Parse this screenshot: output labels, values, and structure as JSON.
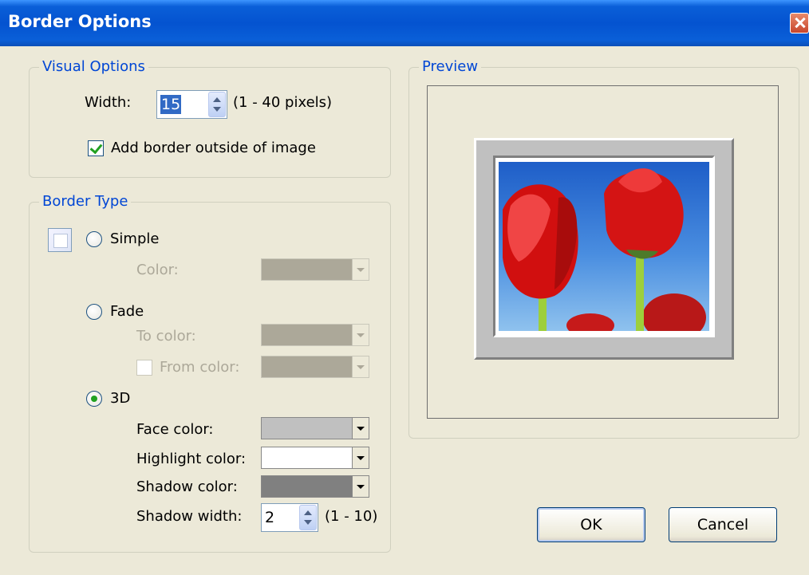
{
  "window": {
    "title": "Border Options"
  },
  "visual_options": {
    "legend": "Visual Options",
    "width_label": "Width:",
    "width_value": "15",
    "width_range": "(1 - 40 pixels)",
    "outside_label": "Add border outside of image",
    "outside_checked": true
  },
  "border_type": {
    "legend": "Border Type",
    "simple": {
      "label": "Simple",
      "selected": false,
      "color_label": "Color:"
    },
    "fade": {
      "label": "Fade",
      "selected": false,
      "to_color_label": "To color:",
      "from_color_label": "From color:"
    },
    "three_d": {
      "label": "3D",
      "selected": true,
      "face_label": "Face color:",
      "highlight_label": "Highlight color:",
      "shadow_label": "Shadow color:",
      "shadow_width_label": "Shadow width:",
      "shadow_width_value": "2",
      "shadow_width_range": "(1 - 10)"
    }
  },
  "preview": {
    "legend": "Preview"
  },
  "buttons": {
    "ok": "OK",
    "cancel": "Cancel"
  },
  "colors": {
    "face": "#c0c0c0",
    "highlight": "#ffffff",
    "shadow": "#808080",
    "disabled_swatch": "#aca899",
    "legend_text": "#0046d5",
    "title_bar": "#0453d0"
  }
}
